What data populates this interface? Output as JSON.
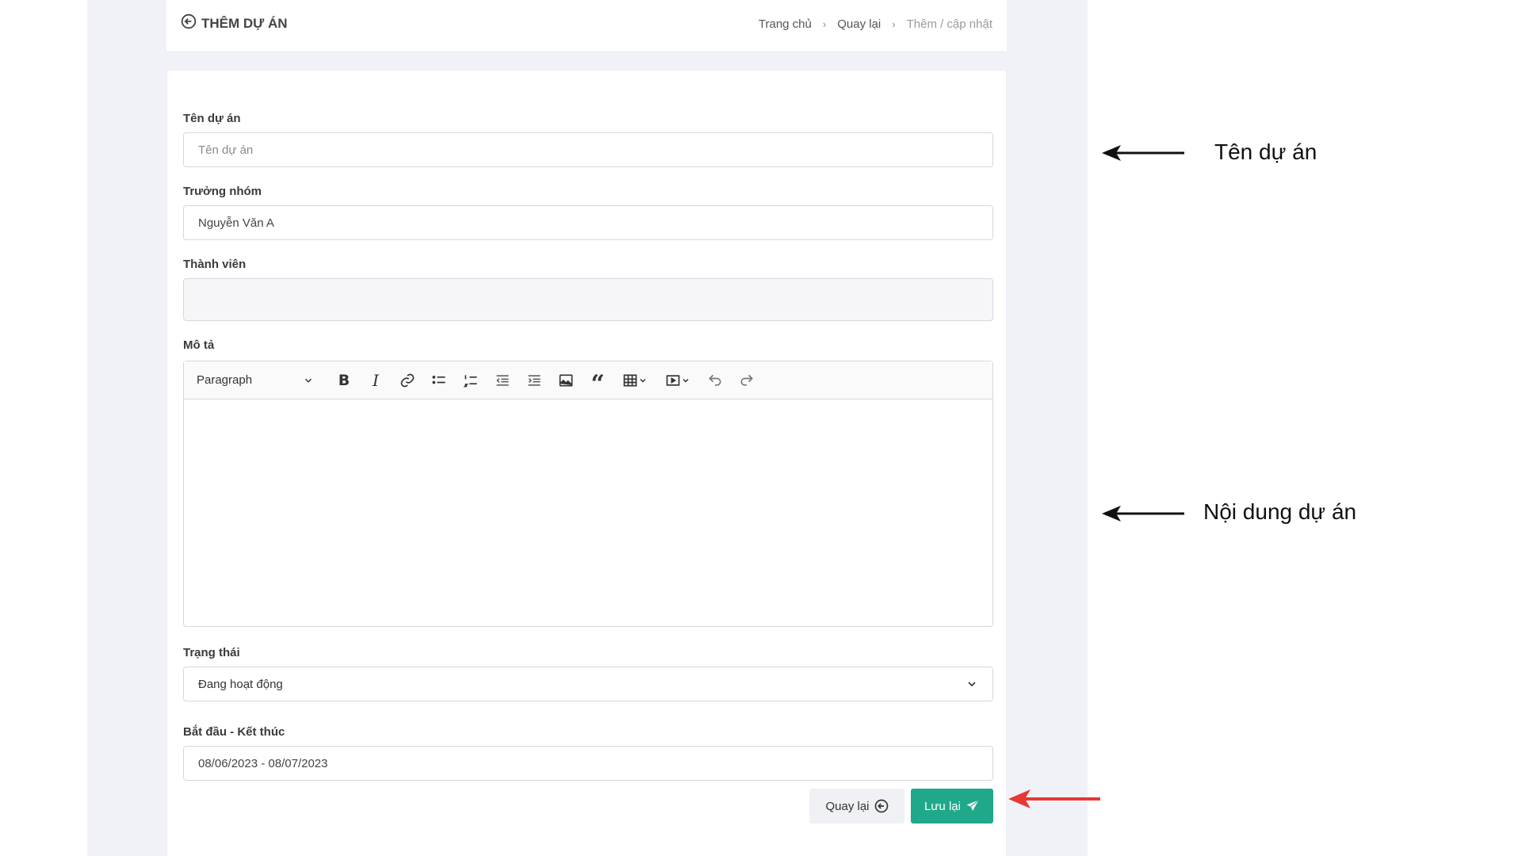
{
  "header": {
    "title": "THÊM DỰ ÁN",
    "breadcrumb": [
      "Trang chủ",
      "Quay lại",
      "Thêm / cập nhật"
    ]
  },
  "form": {
    "project_name": {
      "label": "Tên dự án",
      "placeholder": "Tên dự án"
    },
    "team_lead": {
      "label": "Trưởng nhóm",
      "value": "Nguyễn Văn A"
    },
    "members": {
      "label": "Thành viên",
      "value": ""
    },
    "description": {
      "label": "Mô tả",
      "format_select": "Paragraph",
      "toolbar": [
        "bold-icon",
        "italic-icon",
        "link-icon",
        "bulleted-list-icon",
        "numbered-list-icon",
        "outdent-icon",
        "indent-icon",
        "image-icon",
        "quote-icon",
        "table-icon",
        "media-icon",
        "undo-icon",
        "redo-icon"
      ]
    },
    "status": {
      "label": "Trạng thái",
      "value": "Đang hoạt động"
    },
    "date_range": {
      "label": "Bắt đầu - Kết thúc",
      "value": "08/06/2023 - 08/07/2023"
    }
  },
  "actions": {
    "back_label": "Quay lại",
    "save_label": "Lưu lại"
  },
  "annotations": {
    "name_note": "Tên dự án",
    "content_note": "Nội dung dự án"
  },
  "colors": {
    "primary": "#1fa98a",
    "annotation_red": "#e53935"
  }
}
